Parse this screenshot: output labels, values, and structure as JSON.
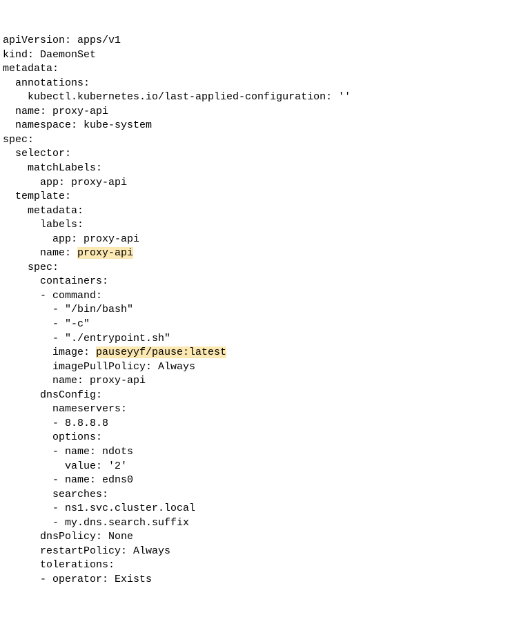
{
  "yaml": {
    "l01": "apiVersion: apps/v1",
    "l02": "kind: DaemonSet",
    "l03": "metadata:",
    "l04": "  annotations:",
    "l05": "    kubectl.kubernetes.io/last-applied-configuration: ''",
    "l06": "  name: proxy-api",
    "l07": "  namespace: kube-system",
    "l08": "spec:",
    "l09": "  selector:",
    "l10": "    matchLabels:",
    "l11": "      app: proxy-api",
    "l12": "  template:",
    "l13": "    metadata:",
    "l14": "      labels:",
    "l15": "        app: proxy-api",
    "l16a": "      name: ",
    "l16b": "proxy-api",
    "l17": "    spec:",
    "l18": "      containers:",
    "l19": "      - command:",
    "l20": "        - \"/bin/bash\"",
    "l21": "        - \"-c\"",
    "l22": "        - \"./entrypoint.sh\"",
    "l23a": "        image: ",
    "l23b": "pauseyyf/pause:latest",
    "l24": "        imagePullPolicy: Always",
    "l25": "        name: proxy-api",
    "l26": "      dnsConfig:",
    "l27": "        nameservers:",
    "l28": "        - 8.8.8.8",
    "l29": "        options:",
    "l30": "        - name: ndots",
    "l31": "          value: '2'",
    "l32": "        - name: edns0",
    "l33": "        searches:",
    "l34": "        - ns1.svc.cluster.local",
    "l35": "        - my.dns.search.suffix",
    "l36": "      dnsPolicy: None",
    "l37": "      restartPolicy: Always",
    "l38": "      tolerations:",
    "l39": "      - operator: Exists"
  }
}
